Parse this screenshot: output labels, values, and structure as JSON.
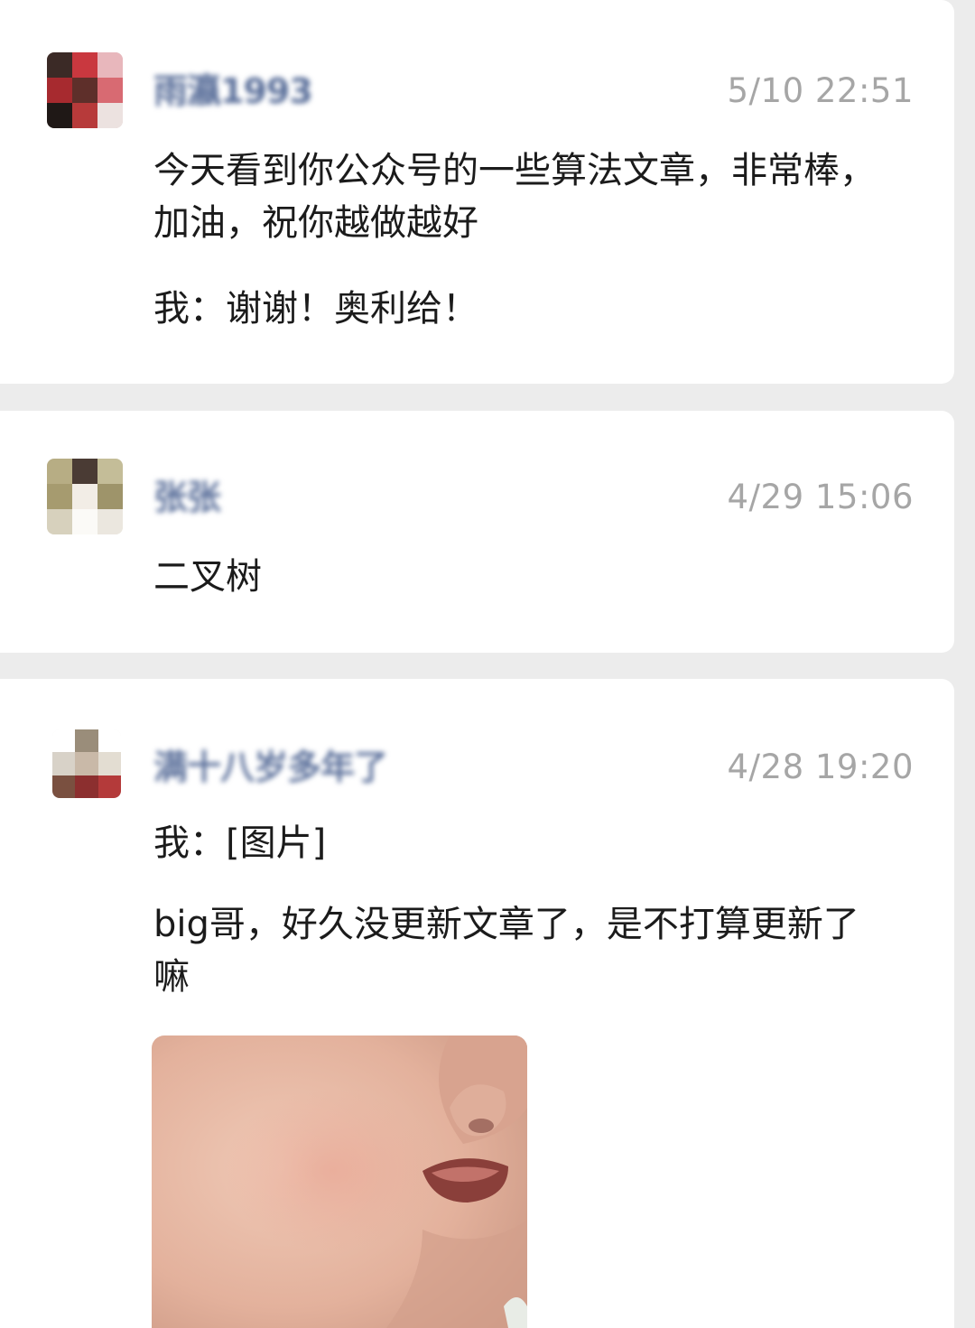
{
  "comments": [
    {
      "name": "雨瀛1993",
      "time": "5/10 22:51",
      "message": "今天看到你公众号的一些算法文章，非常棒，加油，祝你越做越好",
      "reply": "我：谢谢！奥利给！"
    },
    {
      "name": "张张",
      "time": "4/29 15:06",
      "message": "二叉树"
    },
    {
      "name": "满十八岁多年了",
      "time": "4/28 19:20",
      "reply": "我：[图片]",
      "message": "big哥，好久没更新文章了，是不打算更新了嘛",
      "image": "crying-baby-photo"
    }
  ],
  "colors": {
    "background": "#ececec",
    "card": "#ffffff",
    "text": "#1b1b1b",
    "time": "#a6a6a6",
    "name": "#5a6f9a"
  }
}
